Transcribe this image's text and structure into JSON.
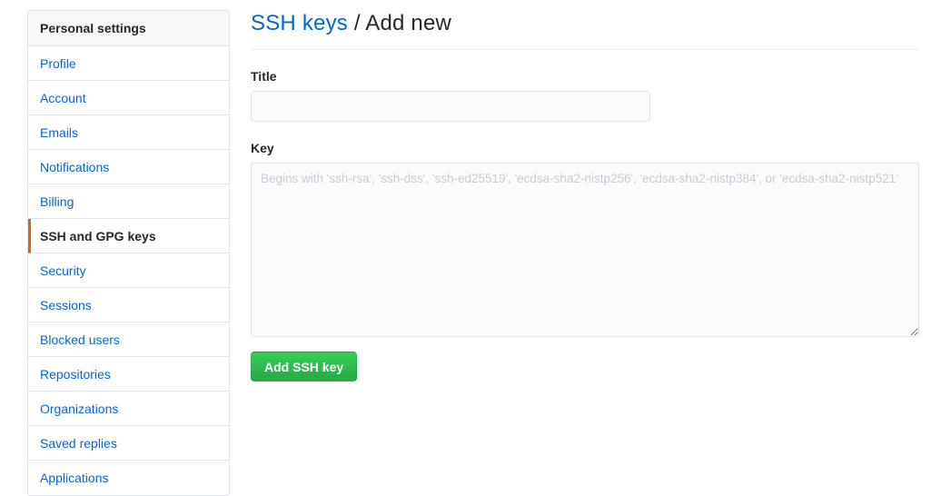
{
  "sidebar": {
    "header": "Personal settings",
    "items": [
      {
        "label": "Profile",
        "selected": false
      },
      {
        "label": "Account",
        "selected": false
      },
      {
        "label": "Emails",
        "selected": false
      },
      {
        "label": "Notifications",
        "selected": false
      },
      {
        "label": "Billing",
        "selected": false
      },
      {
        "label": "SSH and GPG keys",
        "selected": true
      },
      {
        "label": "Security",
        "selected": false
      },
      {
        "label": "Sessions",
        "selected": false
      },
      {
        "label": "Blocked users",
        "selected": false
      },
      {
        "label": "Repositories",
        "selected": false
      },
      {
        "label": "Organizations",
        "selected": false
      },
      {
        "label": "Saved replies",
        "selected": false
      },
      {
        "label": "Applications",
        "selected": false
      }
    ],
    "accent_selected": "#e36209",
    "link_color": "#0366d6",
    "header_bg": "#f6f8fa"
  },
  "main": {
    "title_link": "SSH keys",
    "title_separator": "/",
    "title_current": "Add new",
    "title_sep_and_current": "/ Add new",
    "title_label": "Title",
    "title_value": "",
    "title_placeholder": "",
    "key_label": "Key",
    "key_value": "",
    "key_placeholder": "Begins with 'ssh-rsa', 'ssh-dss', 'ssh-ed25519', 'ecdsa-sha2-nistp256', 'ecdsa-sha2-nistp384', or 'ecdsa-sha2-nistp521'",
    "submit_label": "Add SSH key",
    "submit_color": "#2cbe4e"
  }
}
